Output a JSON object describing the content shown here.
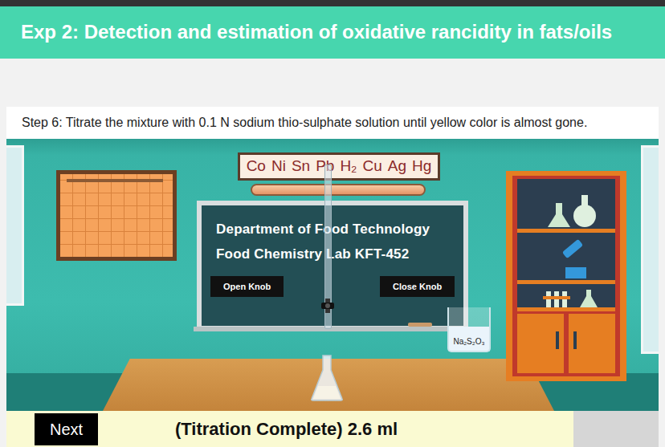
{
  "header": {
    "title": "Exp 2: Detection and estimation of oxidative rancidity in fats/oils"
  },
  "step": {
    "text": "Step 6: Titrate the mixture with 0.1 N sodium thio-sulphate solution until yellow color is almost gone."
  },
  "scene": {
    "element_banner": [
      "Co",
      "Ni",
      "Sn",
      "Pb",
      "H₂",
      "Cu",
      "Ag",
      "Hg"
    ],
    "board_lines": [
      "Department of Food Technology",
      "Food Chemistry Lab KFT-452"
    ],
    "knob_buttons": [
      "Open Knob",
      "Close Knob"
    ],
    "beaker_label": "Na₂S₂O₃"
  },
  "footer": {
    "button": "Next",
    "status": "(Titration Complete) 2.6 ml"
  }
}
